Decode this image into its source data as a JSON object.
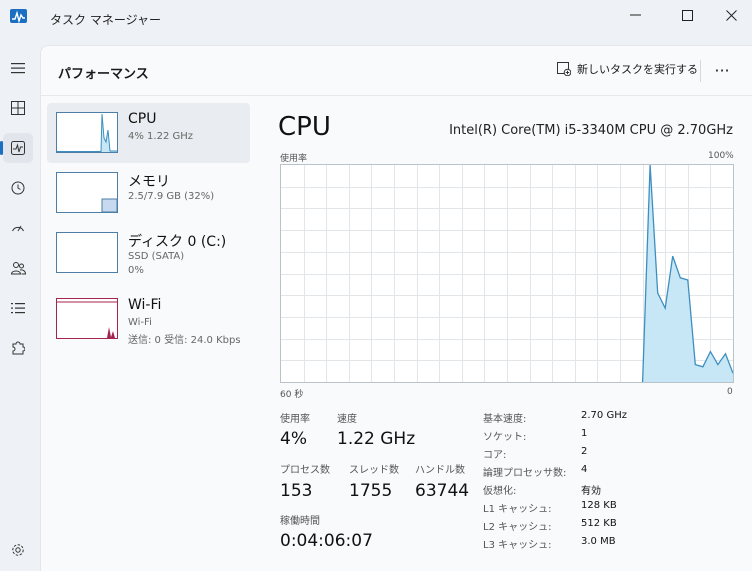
{
  "window": {
    "title": "タスク マネージャー"
  },
  "header": {
    "title": "パフォーマンス",
    "new_task_label": "新しいタスクを実行する"
  },
  "sidebar": {
    "items": [
      {
        "name": "CPU",
        "line1": "4%  1.22 GHz",
        "line2": ""
      },
      {
        "name": "メモリ",
        "line1": "2.5/7.9 GB (32%)",
        "line2": ""
      },
      {
        "name": "ディスク 0 (C:)",
        "line1": "SSD (SATA)",
        "line2": "0%"
      },
      {
        "name": "Wi-Fi",
        "line1": "Wi-Fi",
        "line2": "送信: 0 受信: 24.0 Kbps"
      }
    ]
  },
  "detail": {
    "title": "CPU",
    "model": "Intel(R) Core(TM) i5-3340M CPU @ 2.70GHz",
    "graph_label": "使用率",
    "graph_max": "100%",
    "graph_time": "60 秒",
    "graph_min": "0",
    "stats": {
      "usage_label": "使用率",
      "usage_value": "4%",
      "speed_label": "速度",
      "speed_value": "1.22 GHz",
      "process_label": "プロセス数",
      "process_value": "153",
      "thread_label": "スレッド数",
      "thread_value": "1755",
      "handle_label": "ハンドル数",
      "handle_value": "63744",
      "uptime_label": "稼働時間",
      "uptime_value": "0:04:06:07"
    },
    "specs": [
      {
        "label": "基本速度:",
        "value": "2.70 GHz"
      },
      {
        "label": "ソケット:",
        "value": "1"
      },
      {
        "label": "コア:",
        "value": "2"
      },
      {
        "label": "論理プロセッサ数:",
        "value": "4"
      },
      {
        "label": "仮想化:",
        "value": "有効"
      },
      {
        "label": "L1 キャッシュ:",
        "value": "128 KB"
      },
      {
        "label": "L2 キャッシュ:",
        "value": "512 KB"
      },
      {
        "label": "L3 キャッシュ:",
        "value": "3.0 MB"
      }
    ]
  },
  "colors": {
    "accent": "#1a6fc2",
    "cpu_line": "#3d8fbf",
    "cpu_fill": "#c7e7f6",
    "wifi_line": "#a3254d"
  },
  "chart_data": {
    "type": "area",
    "ylim": [
      0,
      100
    ],
    "x": [
      0,
      1,
      2,
      3,
      4,
      5,
      6,
      7,
      8,
      9,
      10,
      11,
      12,
      13,
      14,
      15,
      16,
      17,
      18,
      19,
      20,
      21,
      22,
      23,
      24,
      25,
      26,
      27,
      28,
      29,
      30,
      31,
      32,
      33,
      34,
      35,
      36,
      37,
      38,
      39,
      40,
      41,
      42,
      43,
      44,
      45,
      46,
      47,
      48,
      49,
      50,
      51,
      52,
      53,
      54,
      55,
      56,
      57,
      58,
      59,
      60
    ],
    "values": [
      0,
      0,
      0,
      0,
      0,
      0,
      0,
      0,
      0,
      0,
      0,
      0,
      0,
      0,
      0,
      0,
      0,
      0,
      0,
      0,
      0,
      0,
      0,
      0,
      0,
      0,
      0,
      0,
      0,
      0,
      0,
      0,
      0,
      0,
      0,
      0,
      0,
      0,
      0,
      0,
      0,
      0,
      0,
      0,
      0,
      0,
      0,
      0,
      0,
      100,
      41,
      34,
      58,
      48,
      47,
      8,
      7,
      14,
      8,
      13,
      4
    ]
  }
}
